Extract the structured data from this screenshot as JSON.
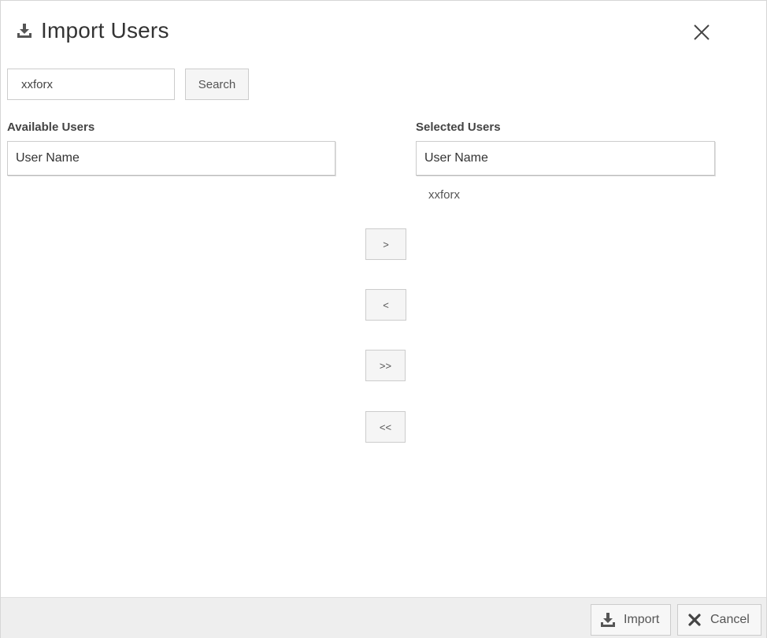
{
  "dialog": {
    "title": "Import Users",
    "title_icon": "import-icon",
    "close_icon": "close-icon"
  },
  "search": {
    "value": "xxforx",
    "button_label": "Search"
  },
  "available": {
    "label": "Available Users",
    "column_header": "User Name",
    "items": []
  },
  "selected": {
    "label": "Selected Users",
    "column_header": "User Name",
    "items": [
      "xxforx"
    ]
  },
  "move_buttons": {
    "add": ">",
    "remove": "<",
    "add_all": ">>",
    "remove_all": "<<"
  },
  "footer": {
    "import_label": "Import",
    "import_icon": "import-icon",
    "cancel_label": "Cancel",
    "cancel_icon": "cancel-icon"
  },
  "colors": {
    "footer_bg": "#eeeeee",
    "button_bg": "#f5f5f5",
    "border": "#cccccc",
    "text": "#333333"
  }
}
